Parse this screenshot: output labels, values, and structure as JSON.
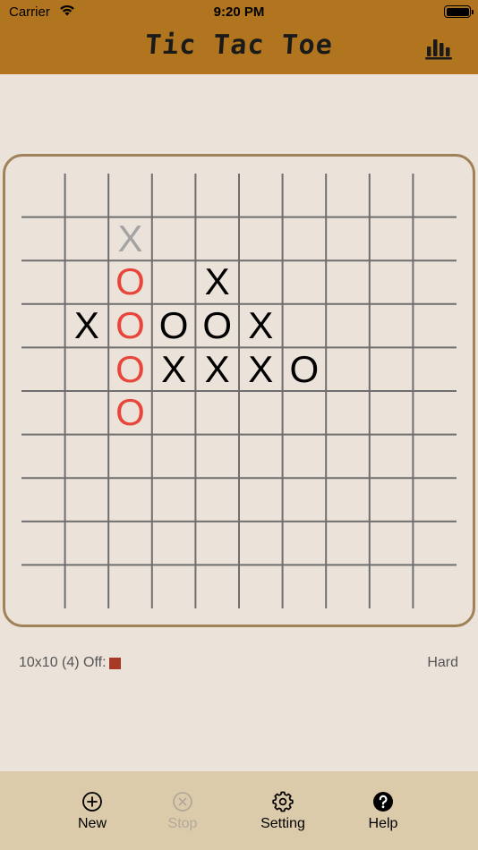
{
  "status": {
    "carrier": "Carrier",
    "time": "9:20 PM"
  },
  "header": {
    "title": "Tic Tac Toe"
  },
  "colors": {
    "header_bg": "#b0751e",
    "toolbar_bg": "#dccbab",
    "board_border": "#a08159",
    "x_color": "#000000",
    "o_color": "#000000",
    "win_color": "#e8463a",
    "last_move_color": "#a3a3a3",
    "off_swatch": "#a63a24"
  },
  "board": {
    "size": 10,
    "pieces": [
      {
        "row": 1,
        "col": 2,
        "mark": "X",
        "style": "last"
      },
      {
        "row": 2,
        "col": 2,
        "mark": "O",
        "style": "win"
      },
      {
        "row": 2,
        "col": 4,
        "mark": "X",
        "style": "normal"
      },
      {
        "row": 3,
        "col": 1,
        "mark": "X",
        "style": "normal"
      },
      {
        "row": 3,
        "col": 2,
        "mark": "O",
        "style": "win"
      },
      {
        "row": 3,
        "col": 3,
        "mark": "O",
        "style": "normal"
      },
      {
        "row": 3,
        "col": 4,
        "mark": "O",
        "style": "normal"
      },
      {
        "row": 3,
        "col": 5,
        "mark": "X",
        "style": "normal"
      },
      {
        "row": 4,
        "col": 2,
        "mark": "O",
        "style": "win"
      },
      {
        "row": 4,
        "col": 3,
        "mark": "X",
        "style": "normal"
      },
      {
        "row": 4,
        "col": 4,
        "mark": "X",
        "style": "normal"
      },
      {
        "row": 4,
        "col": 5,
        "mark": "X",
        "style": "normal"
      },
      {
        "row": 4,
        "col": 6,
        "mark": "O",
        "style": "normal"
      },
      {
        "row": 5,
        "col": 2,
        "mark": "O",
        "style": "win"
      }
    ]
  },
  "info": {
    "mode_label": "10x10 (4) Off:",
    "difficulty": "Hard"
  },
  "toolbar": {
    "new_label": "New",
    "stop_label": "Stop",
    "setting_label": "Setting",
    "help_label": "Help"
  }
}
